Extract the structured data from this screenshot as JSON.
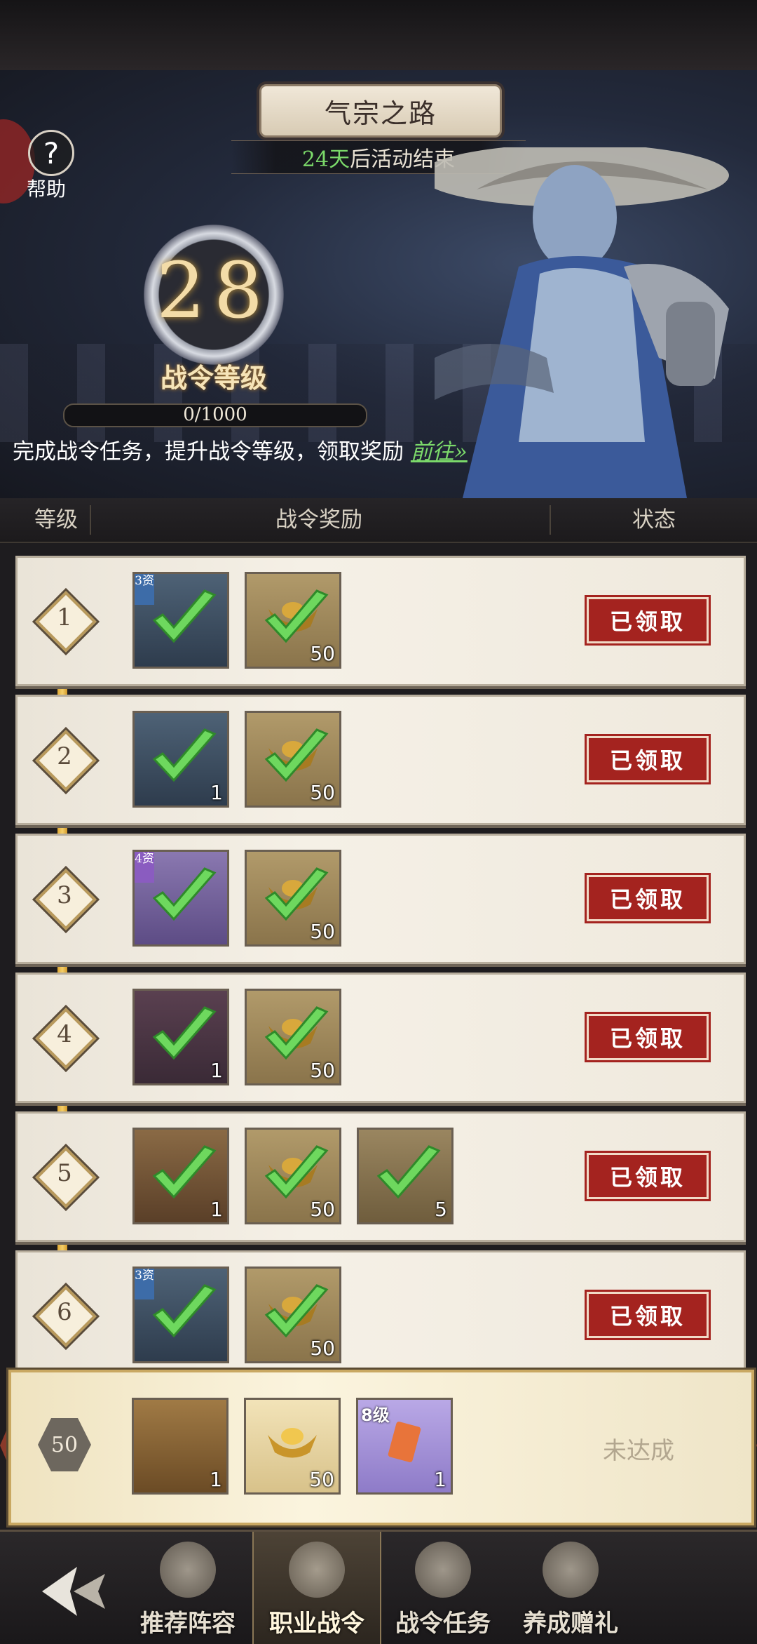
{
  "header": {
    "title": "气宗之路",
    "days": "24天",
    "end_suffix": "后活动结束",
    "help_label": "帮助"
  },
  "level_panel": {
    "level": "28",
    "level_title": "战令等级",
    "progress_text": "0/1000",
    "progress_fraction": 0,
    "description": "完成战令任务，提升战令等级，领取奖励",
    "goto_label": "前往»"
  },
  "table_header": {
    "col_level": "等级",
    "col_rewards": "战令奖励",
    "col_status": "状态"
  },
  "rows": [
    {
      "level": "1",
      "status": "已领取",
      "items": [
        {
          "count": "",
          "tag": "3资"
        },
        {
          "count": "50"
        }
      ]
    },
    {
      "level": "2",
      "status": "已领取",
      "items": [
        {
          "count": "1"
        },
        {
          "count": "50"
        }
      ]
    },
    {
      "level": "3",
      "status": "已领取",
      "items": [
        {
          "count": "",
          "tag": "4资"
        },
        {
          "count": "50"
        }
      ]
    },
    {
      "level": "4",
      "status": "已领取",
      "items": [
        {
          "count": "1"
        },
        {
          "count": "50"
        }
      ]
    },
    {
      "level": "5",
      "status": "已领取",
      "items": [
        {
          "count": "1"
        },
        {
          "count": "50"
        },
        {
          "count": "5"
        }
      ]
    },
    {
      "level": "6",
      "status": "已领取",
      "items": [
        {
          "count": "",
          "tag": "3资"
        },
        {
          "count": "50"
        }
      ]
    }
  ],
  "pinned_row": {
    "level": "50",
    "status": "未达成",
    "items": [
      {
        "count": "1"
      },
      {
        "count": "50"
      },
      {
        "count": "1",
        "level_tag": "8级"
      }
    ]
  },
  "nav": {
    "tabs": [
      "推荐阵容",
      "职业战令",
      "战令任务",
      "养成赠礼"
    ],
    "active_index": 1
  },
  "colors": {
    "accent_green": "#7bd96a",
    "stamp_red": "#a4231f",
    "rail_gold": "#f4cf6a"
  }
}
